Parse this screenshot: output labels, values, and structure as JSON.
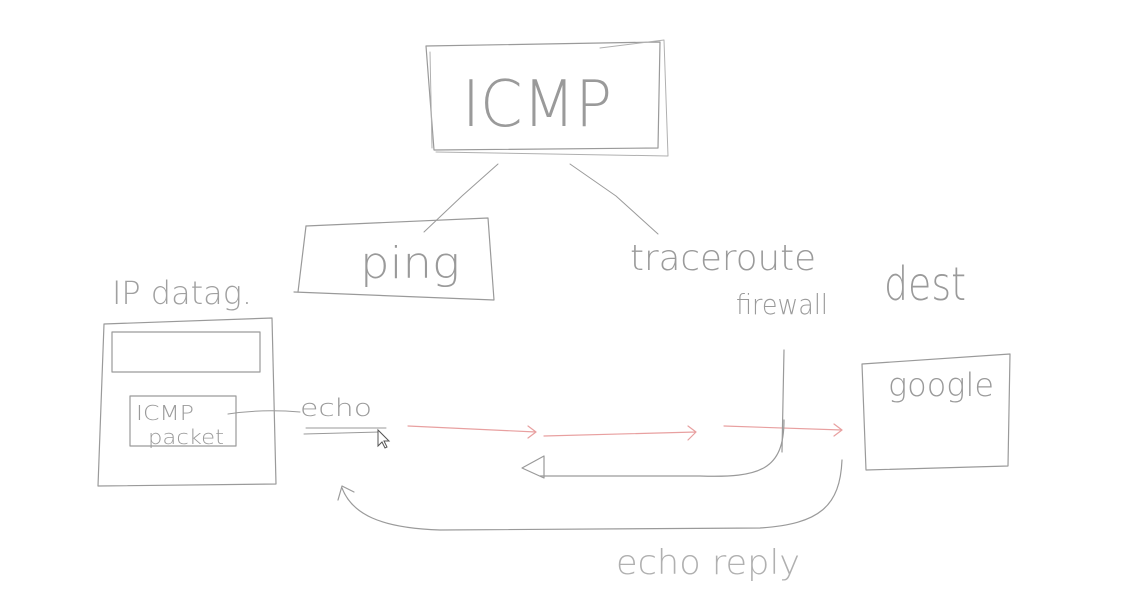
{
  "labels": {
    "icmp": "ICMP",
    "ping": "ping",
    "traceroute": "traceroute",
    "ip_datagram": "IP datag.",
    "icmp_packet_line1": "ICMP",
    "icmp_packet_line2": "packet",
    "echo": "echo",
    "firewall": "firewall",
    "dest": "dest",
    "google": "google",
    "echo_reply": "echo reply"
  },
  "colors": {
    "ink": "#9a9a9a",
    "ink_light": "#c4c4c4",
    "red_ink": "#e8a0a0",
    "cursor": "#555555"
  },
  "icons": {
    "cursor": "mouse-pointer-icon"
  }
}
